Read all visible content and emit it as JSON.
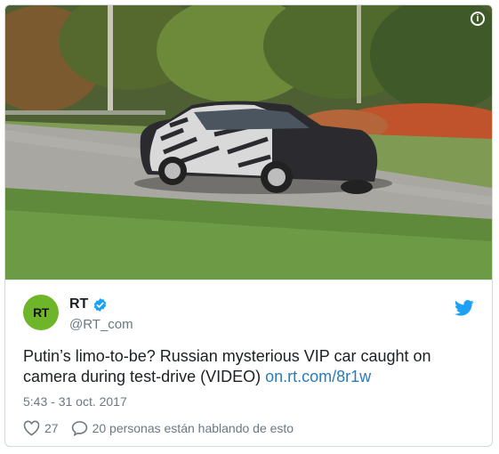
{
  "tweet": {
    "name": "RT",
    "handle": "@RT_com",
    "avatar_text": "RT",
    "text": "Putin’s limo-to-be? Russian mysterious VIP car caught on camera during test-drive (VIDEO) ",
    "link": "on.rt.com/8r1w",
    "timestamp": "5:43 - 31 oct. 2017",
    "likes": "27",
    "replies_label": "20 personas están hablando de esto"
  },
  "icons": {
    "info": "info-icon",
    "verified": "verified-badge-icon",
    "bird": "twitter-bird-icon",
    "heart": "heart-icon",
    "comment": "comment-bubble-icon"
  },
  "colors": {
    "link": "#2b7bb9",
    "verified": "#1da1f2",
    "avatar": "#6fb529",
    "muted": "#697882"
  }
}
